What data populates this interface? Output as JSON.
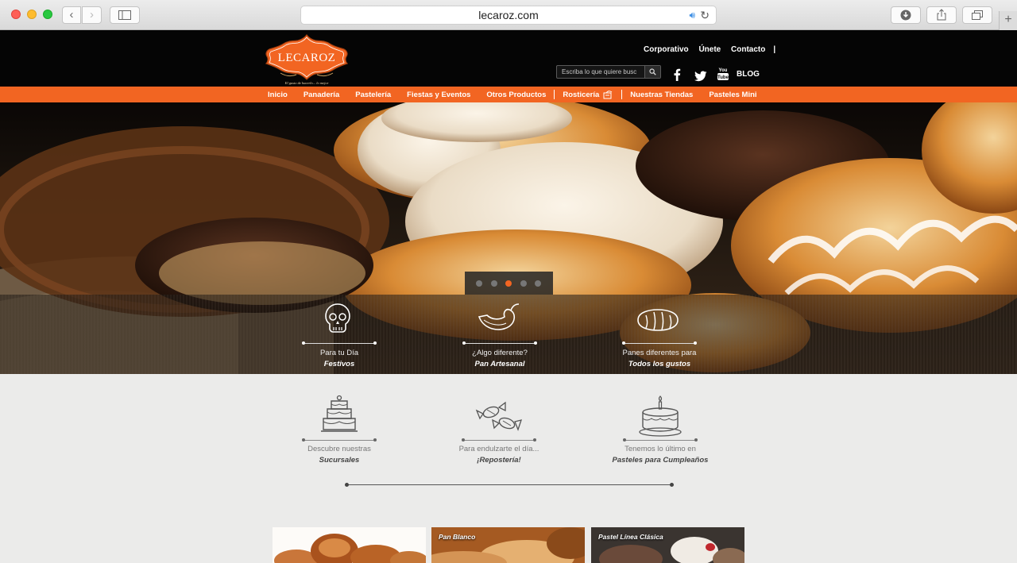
{
  "browser": {
    "url": "lecaroz.com"
  },
  "header": {
    "logo_text": "LECAROZ",
    "logo_tagline": "El gusto de hacerlo... lo mejor",
    "top_links": [
      "Corporativo",
      "Únete",
      "Contacto"
    ],
    "search_placeholder": "Escriba lo que quiere busc",
    "social": [
      "facebook-icon",
      "twitter-icon",
      "youtube-icon"
    ],
    "blog_label": "BLOG"
  },
  "nav": {
    "items": [
      "Inicio",
      "Panadería",
      "Pastelería",
      "Fiestas y Eventos",
      "Otros Productos",
      "Rosticería",
      "Nuestras Tiendas",
      "Pasteles Mini"
    ]
  },
  "hero": {
    "slide_count": 5,
    "active_slide": 3,
    "features": [
      {
        "line1": "Para tu Día",
        "line2": "Festivos",
        "icon": "skull-icon"
      },
      {
        "line1": "¿Algo diferente?",
        "line2": "Pan Artesanal",
        "icon": "pepper-icon"
      },
      {
        "line1": "Panes diferentes para",
        "line2": "Todos los gustos",
        "icon": "bread-icon"
      }
    ]
  },
  "sections": [
    {
      "line1": "Descubre nuestras",
      "line2": "Sucursales",
      "icon": "cake-icon"
    },
    {
      "line1": "Para endulzarte el día...",
      "line2": "¡Repostería!",
      "icon": "candy-icon"
    },
    {
      "line1": "Tenemos lo último en",
      "line2": "Pasteles para Cumpleaños",
      "icon": "birthday-cake-icon"
    }
  ],
  "cards": [
    {
      "label": ""
    },
    {
      "label": "Pan Blanco"
    },
    {
      "label": "Pastel Línea Clásica"
    }
  ],
  "colors": {
    "brand_orange": "#f26522",
    "header_black": "#050505",
    "page_bg": "#ebebea"
  }
}
